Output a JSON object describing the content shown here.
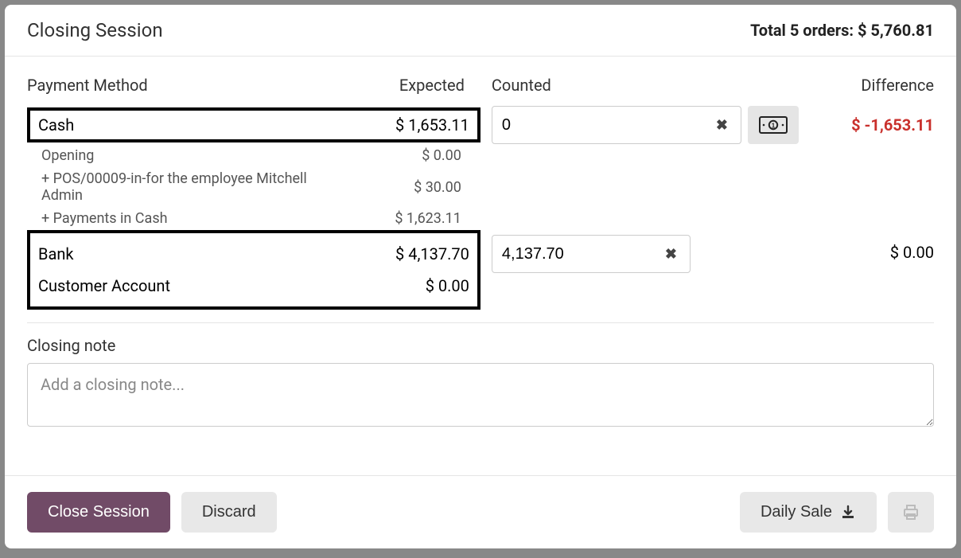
{
  "header": {
    "title": "Closing Session",
    "summary_prefix": "Total ",
    "summary_count": "5",
    "summary_orders": " orders: ",
    "summary_amount": "$ 5,760.81"
  },
  "columns": {
    "method": "Payment Method",
    "expected": "Expected",
    "counted": "Counted",
    "difference": "Difference"
  },
  "cash": {
    "label": "Cash",
    "expected": "$ 1,653.11",
    "counted_value": "0",
    "difference": "$ -1,653.11",
    "details": [
      {
        "label": "Opening",
        "value": "$ 0.00"
      },
      {
        "label": "+ POS/00009-in-for the employee Mitchell Admin",
        "value": "$ 30.00"
      },
      {
        "label": "+ Payments in Cash",
        "value": "$ 1,623.11"
      }
    ]
  },
  "other_methods": [
    {
      "label": "Bank",
      "expected": "$ 4,137.70",
      "counted_value": "4,137.70",
      "difference": "$ 0.00",
      "has_input": true
    },
    {
      "label": "Customer Account",
      "expected": "$ 0.00",
      "has_input": false
    }
  ],
  "closing_note": {
    "label": "Closing note",
    "placeholder": "Add a closing note..."
  },
  "footer": {
    "close": "Close Session",
    "discard": "Discard",
    "daily_sale": "Daily Sale"
  },
  "icons": {
    "clear": "clear-icon",
    "cash": "money-bill-icon",
    "download": "download-icon",
    "print": "print-icon"
  }
}
